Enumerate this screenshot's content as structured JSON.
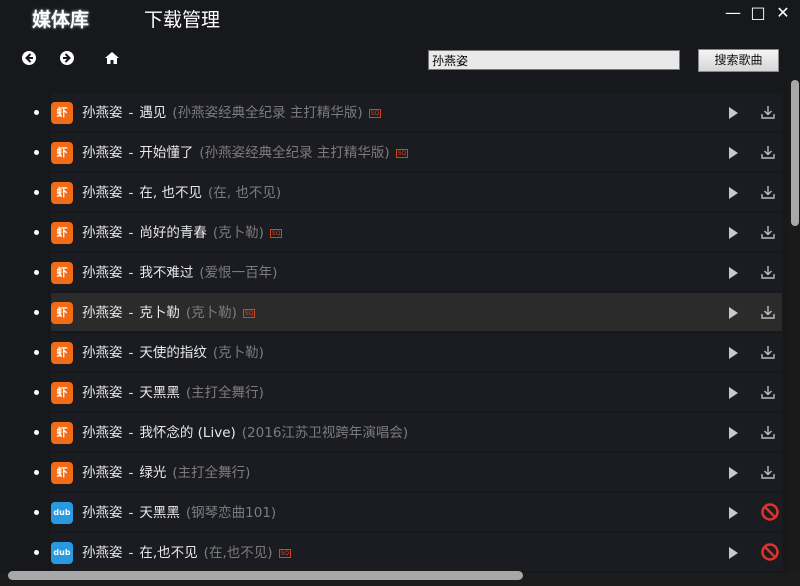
{
  "tabs": [
    {
      "label": "媒体库",
      "active": true
    },
    {
      "label": "下载管理",
      "active": false
    }
  ],
  "window_controls": {
    "minimize": "—",
    "maximize": "□",
    "close": "✕"
  },
  "search": {
    "value": "孙燕姿",
    "button": "搜索歌曲"
  },
  "sq_badge": "SQ",
  "separator": "-",
  "songs": [
    {
      "source": "xiami",
      "icon": "虾",
      "artist": "孙燕姿",
      "title": "遇见",
      "album": "(孙燕姿经典全纪录 主打精华版)",
      "sq": true,
      "action": "download"
    },
    {
      "source": "xiami",
      "icon": "虾",
      "artist": "孙燕姿",
      "title": "开始懂了",
      "album": "(孙燕姿经典全纪录 主打精华版)",
      "sq": true,
      "action": "download"
    },
    {
      "source": "xiami",
      "icon": "虾",
      "artist": "孙燕姿",
      "title": "在, 也不见",
      "album": "(在, 也不见)",
      "sq": false,
      "action": "download"
    },
    {
      "source": "xiami",
      "icon": "虾",
      "artist": "孙燕姿",
      "title": "尚好的青春",
      "album": "(克卜勒)",
      "sq": true,
      "action": "download"
    },
    {
      "source": "xiami",
      "icon": "虾",
      "artist": "孙燕姿",
      "title": "我不难过",
      "album": "(爱恨一百年)",
      "sq": false,
      "action": "download"
    },
    {
      "source": "xiami",
      "icon": "虾",
      "artist": "孙燕姿",
      "title": "克卜勒",
      "album": "(克卜勒)",
      "sq": true,
      "action": "download",
      "highlighted": true
    },
    {
      "source": "xiami",
      "icon": "虾",
      "artist": "孙燕姿",
      "title": "天使的指纹",
      "album": "(克卜勒)",
      "sq": false,
      "action": "download"
    },
    {
      "source": "xiami",
      "icon": "虾",
      "artist": "孙燕姿",
      "title": "天黑黑",
      "album": "(主打全舞行)",
      "sq": false,
      "action": "download"
    },
    {
      "source": "xiami",
      "icon": "虾",
      "artist": "孙燕姿",
      "title": "我怀念的 (Live)",
      "album": "(2016江苏卫视跨年演唱会)",
      "sq": false,
      "action": "download"
    },
    {
      "source": "xiami",
      "icon": "虾",
      "artist": "孙燕姿",
      "title": "绿光",
      "album": "(主打全舞行)",
      "sq": false,
      "action": "download"
    },
    {
      "source": "duoting",
      "icon": "dub",
      "artist": "孙燕姿",
      "title": "天黑黑",
      "album": "(钢琴恋曲101)",
      "sq": false,
      "action": "blocked"
    },
    {
      "source": "duoting",
      "icon": "dub",
      "artist": "孙燕姿",
      "title": "在,也不见",
      "album": "(在,也不见)",
      "sq": true,
      "action": "blocked"
    }
  ]
}
